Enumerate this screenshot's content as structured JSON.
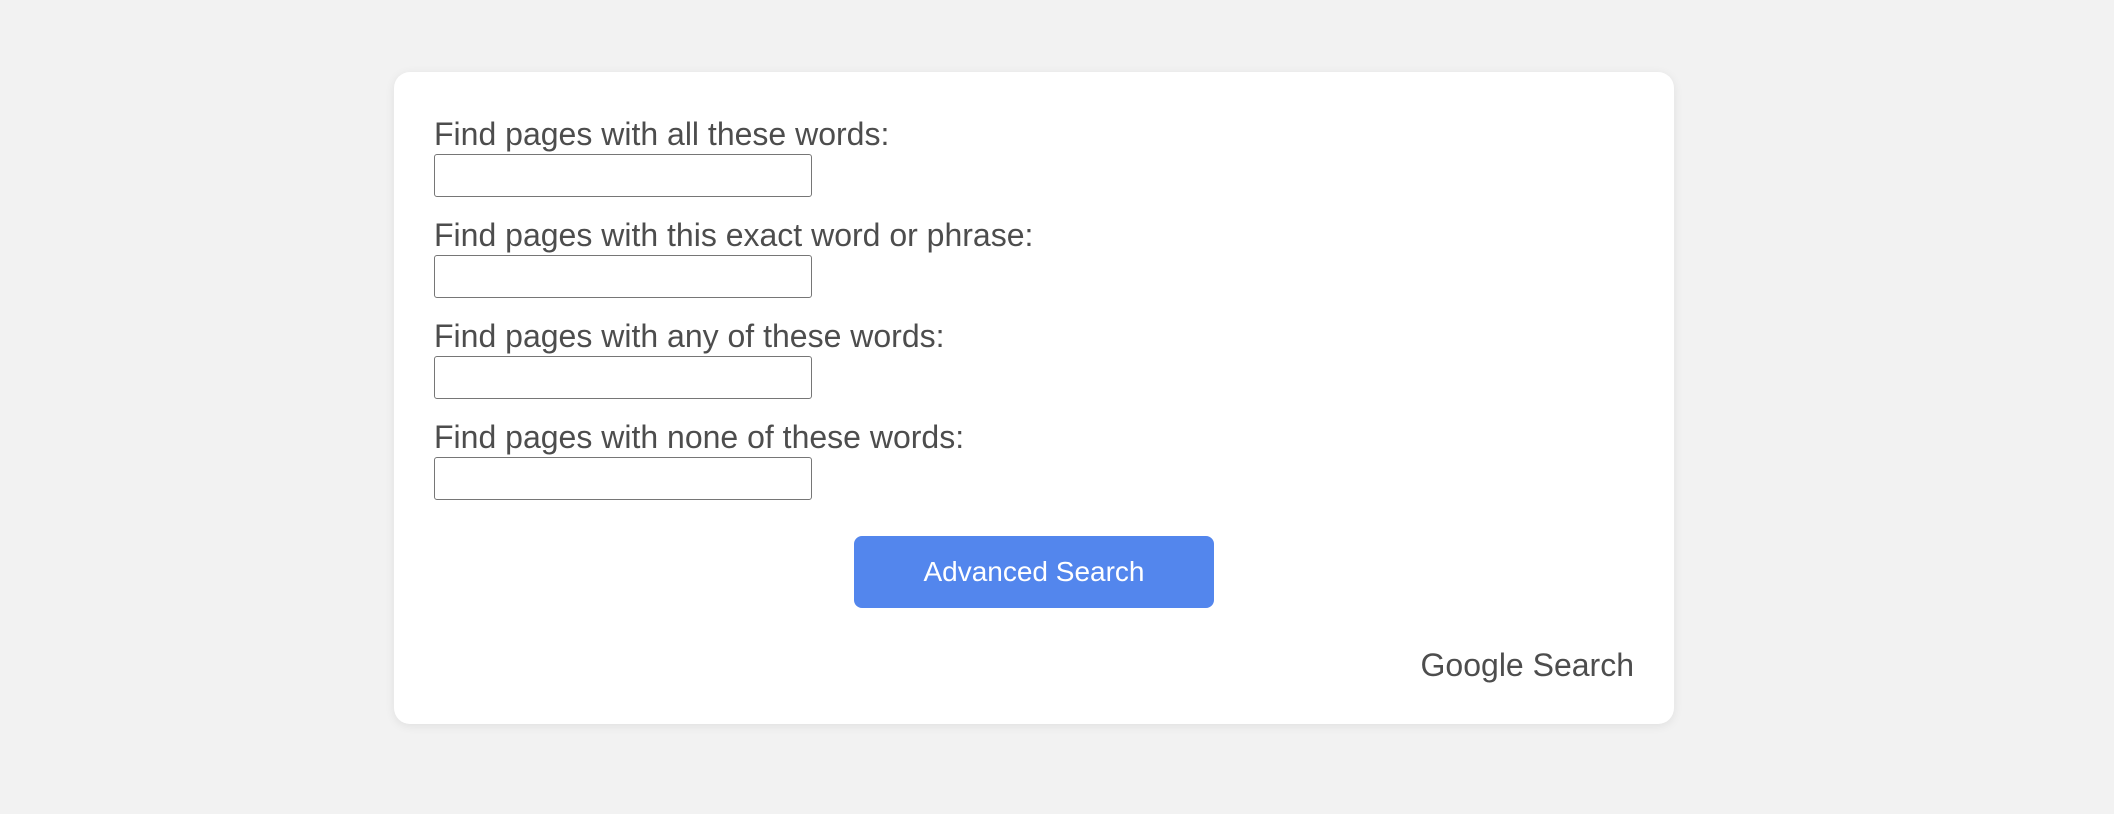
{
  "form": {
    "fields": [
      {
        "label": "Find pages with all these words:",
        "value": "",
        "placeholder": ""
      },
      {
        "label": "Find pages with this exact word or phrase:",
        "value": "",
        "placeholder": ""
      },
      {
        "label": "Find pages with any of these words:",
        "value": "",
        "placeholder": ""
      },
      {
        "label": "Find pages with none of these words:",
        "value": "",
        "placeholder": ""
      }
    ],
    "submit_label": "Advanced Search"
  },
  "footer": {
    "link_label": "Google Search"
  },
  "colors": {
    "page_background": "#f2f2f2",
    "card_background": "#ffffff",
    "button_background": "#5386ed",
    "button_text": "#ffffff",
    "text": "#4d4d4d"
  }
}
